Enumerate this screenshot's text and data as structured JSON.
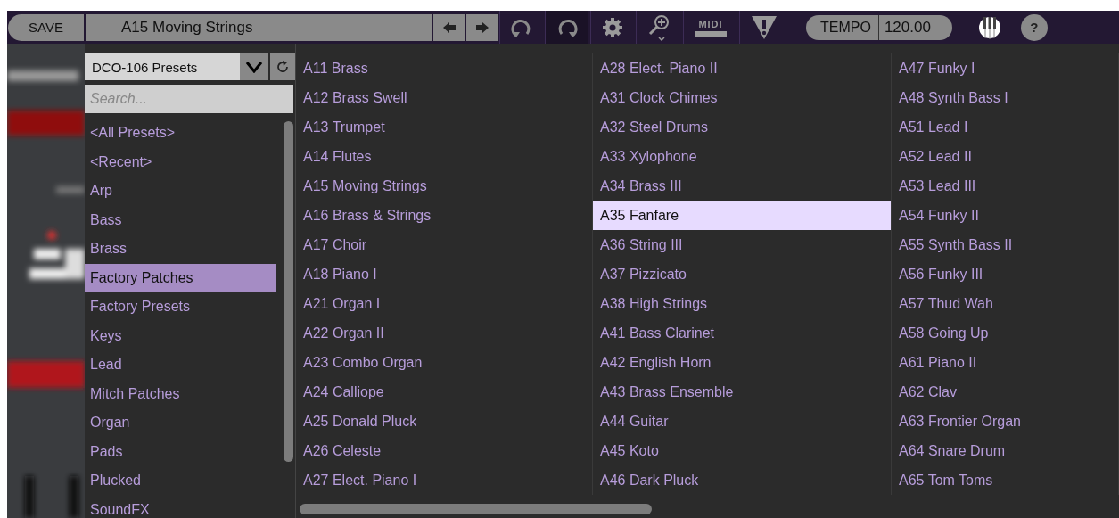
{
  "toolbar": {
    "save_label": "SAVE",
    "preset_name": "A15 Moving Strings",
    "midi_label": "MIDI",
    "tempo_label": "TEMPO",
    "tempo_value": "120.00",
    "help_label": "?"
  },
  "bank": {
    "name": "DCO-106 Presets"
  },
  "search": {
    "placeholder": "Search..."
  },
  "categories": [
    {
      "label": "<All Presets>",
      "selected": false
    },
    {
      "label": "<Recent>",
      "selected": false
    },
    {
      "label": "Arp",
      "selected": false
    },
    {
      "label": "Bass",
      "selected": false
    },
    {
      "label": "Brass",
      "selected": false
    },
    {
      "label": "Factory Patches",
      "selected": true
    },
    {
      "label": "Factory Presets",
      "selected": false
    },
    {
      "label": "Keys",
      "selected": false
    },
    {
      "label": "Lead",
      "selected": false
    },
    {
      "label": "Mitch Patches",
      "selected": false
    },
    {
      "label": "Organ",
      "selected": false
    },
    {
      "label": "Pads",
      "selected": false
    },
    {
      "label": "Plucked",
      "selected": false
    },
    {
      "label": "SoundFX",
      "selected": false
    }
  ],
  "presets": [
    {
      "name": "A11 Brass",
      "selected": false
    },
    {
      "name": "A12 Brass Swell",
      "selected": false
    },
    {
      "name": "A13 Trumpet",
      "selected": false
    },
    {
      "name": "A14 Flutes",
      "selected": false
    },
    {
      "name": "A15 Moving Strings",
      "selected": false
    },
    {
      "name": "A16 Brass & Strings",
      "selected": false
    },
    {
      "name": "A17 Choir",
      "selected": false
    },
    {
      "name": "A18 Piano I",
      "selected": false
    },
    {
      "name": "A21 Organ I",
      "selected": false
    },
    {
      "name": "A22 Organ II",
      "selected": false
    },
    {
      "name": "A23 Combo Organ",
      "selected": false
    },
    {
      "name": "A24 Calliope",
      "selected": false
    },
    {
      "name": "A25 Donald Pluck",
      "selected": false
    },
    {
      "name": "A26 Celeste",
      "selected": false
    },
    {
      "name": "A27 Elect. Piano I",
      "selected": false
    },
    {
      "name": "A28 Elect. Piano II",
      "selected": false
    },
    {
      "name": "A31 Clock Chimes",
      "selected": false
    },
    {
      "name": "A32 Steel Drums",
      "selected": false
    },
    {
      "name": "A33 Xylophone",
      "selected": false
    },
    {
      "name": "A34 Brass III",
      "selected": false
    },
    {
      "name": "A35 Fanfare",
      "selected": true
    },
    {
      "name": "A36 String III",
      "selected": false
    },
    {
      "name": "A37 Pizzicato",
      "selected": false
    },
    {
      "name": "A38 High Strings",
      "selected": false
    },
    {
      "name": "A41 Bass Clarinet",
      "selected": false
    },
    {
      "name": "A42 English Horn",
      "selected": false
    },
    {
      "name": "A43 Brass Ensemble",
      "selected": false
    },
    {
      "name": "A44 Guitar",
      "selected": false
    },
    {
      "name": "A45 Koto",
      "selected": false
    },
    {
      "name": "A46 Dark Pluck",
      "selected": false
    },
    {
      "name": "A47 Funky I",
      "selected": false
    },
    {
      "name": "A48 Synth Bass I",
      "selected": false
    },
    {
      "name": "A51 Lead I",
      "selected": false
    },
    {
      "name": "A52 Lead II",
      "selected": false
    },
    {
      "name": "A53 Lead III",
      "selected": false
    },
    {
      "name": "A54 Funky II",
      "selected": false
    },
    {
      "name": "A55 Synth Bass II",
      "selected": false
    },
    {
      "name": "A56 Funky III",
      "selected": false
    },
    {
      "name": "A57 Thud Wah",
      "selected": false
    },
    {
      "name": "A58 Going Up",
      "selected": false
    },
    {
      "name": "A61 Piano II",
      "selected": false
    },
    {
      "name": "A62 Clav",
      "selected": false
    },
    {
      "name": "A63 Frontier Organ",
      "selected": false
    },
    {
      "name": "A64 Snare Drum",
      "selected": false
    },
    {
      "name": "A65 Tom Toms",
      "selected": false
    }
  ]
}
